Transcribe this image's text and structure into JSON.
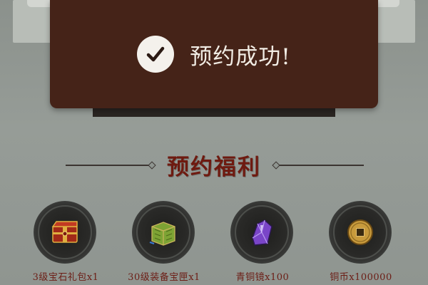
{
  "toast": {
    "message": "预约成功!",
    "icon": "check-icon"
  },
  "section": {
    "title": "预约福利"
  },
  "rewards": [
    {
      "label": "3级宝石礼包x1",
      "icon": "red-chest-icon",
      "color": "#b5321e"
    },
    {
      "label": "30级装备宝匣x1",
      "icon": "green-chest-icon",
      "color": "#6a8f2a"
    },
    {
      "label": "青铜镜x100",
      "icon": "purple-crystal-icon",
      "color": "#8a4fd6"
    },
    {
      "label": "铜币x100000",
      "icon": "copper-coin-icon",
      "color": "#c79a3a"
    }
  ],
  "colors": {
    "toast_bg": "#452318",
    "title_red": "#6e1a10",
    "background": "#8f9590"
  }
}
